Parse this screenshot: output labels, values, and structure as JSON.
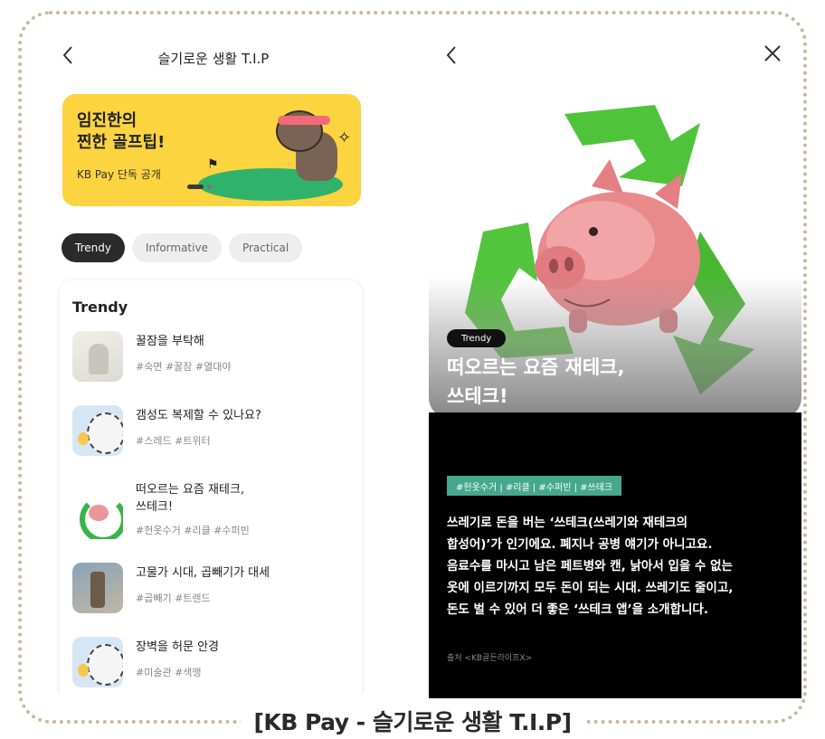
{
  "caption": "[KB Pay - 슬기로운 생활 T.I.P]",
  "left_screen": {
    "title": "슬기로운 생활 T.I.P",
    "back_icon": "chevron-left-icon",
    "banner": {
      "line1": "임진한의",
      "line2": "찐한 골프팁!",
      "subtitle": "KB Pay 단독 공개",
      "background": "#fcd440"
    },
    "tabs": [
      {
        "label": "Trendy",
        "active": true
      },
      {
        "label": "Informative",
        "active": false
      },
      {
        "label": "Practical",
        "active": false
      }
    ],
    "section_title": "Trendy",
    "items": [
      {
        "title": "꿀잠을 부탁해",
        "tags": "#숙면 #꿀잠 #열대야"
      },
      {
        "title": "갬성도 복제할 수 있나요?",
        "tags": "#스레드 #트위터"
      },
      {
        "title": "떠오르는 요즘 재테크,",
        "title2": "쓰테크!",
        "tags": "#헌옷수거 #리클 #수퍼빈"
      },
      {
        "title": "고물가 시대, 곱빼기가 대세",
        "tags": "#곱빼기 #트렌드"
      },
      {
        "title": "장벽을 허문 안경",
        "tags": "#미술관 #색맹"
      }
    ]
  },
  "right_screen": {
    "back_icon": "chevron-left-icon",
    "close_icon": "close-icon",
    "badge": "Trendy",
    "title_line1": "떠오르는 요즘 재테크,",
    "title_line2": "쓰테크!",
    "tags": "#헌옷수거 | #리클 | #수퍼빈 | #쓰테크",
    "tag_color": "#45a88c",
    "body_lines": [
      "쓰레기로 돈을 버는 ‘쓰테크(쓰레기와 재테크의",
      "합성어)’가 인기에요. 폐지나 공병 얘기가 아니고요.",
      "음료수를 마시고 남은 페트병와 캔, 낡아서 입을 수 없는",
      "옷에 이르기까지 모두 돈이 되는 시대. 쓰레기도 줄이고,",
      "돈도 벌 수 있어 더 좋은 ‘쓰테크 앱’을 소개합니다."
    ],
    "source": "출처 <KB골든라이프X>"
  }
}
